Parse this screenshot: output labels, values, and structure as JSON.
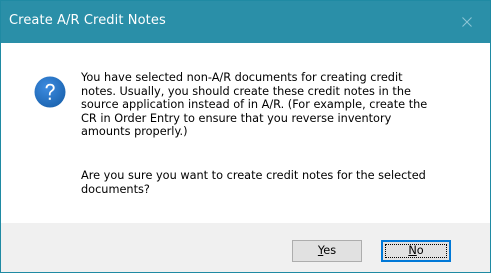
{
  "window": {
    "title": "Create A/R Credit Notes",
    "close_icon": "close-icon"
  },
  "message": {
    "icon": "question-icon",
    "paragraph1": "You have selected non-A/R documents for creating credit\nnotes. Usually, you should create these credit notes in the\nsource application instead of in A/R. (For example, create the\nCR in Order Entry to ensure that you reverse inventory\namounts properly.)",
    "paragraph2": "Are you sure you want to create credit notes for the selected\ndocuments?"
  },
  "buttons": {
    "yes": {
      "mnemonic": "Y",
      "rest": "es"
    },
    "no": {
      "mnemonic": "N",
      "rest": "o"
    }
  },
  "colors": {
    "titlebar": "#2a8fa8",
    "icon_blue": "#1b64b0",
    "focus_border": "#0078d7"
  }
}
